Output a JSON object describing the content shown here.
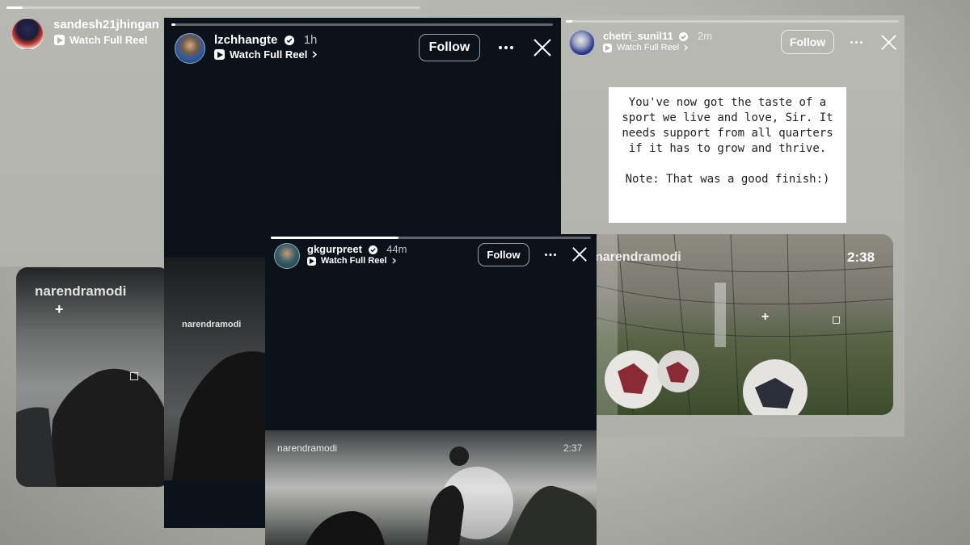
{
  "colors": {
    "dark_panel": "#0b121a",
    "follow_border": "#d0d0d0"
  },
  "card_sandesh": {
    "username": "sandesh21jhingan",
    "reel_link": "Watch Full Reel"
  },
  "card_lz": {
    "username": "lzchhangte",
    "time": "1h",
    "reel_link": "Watch Full Reel",
    "follow": "Follow",
    "video_watermark": "narendramodi"
  },
  "card_chetri": {
    "username": "chetri_sunil11",
    "time": "2m",
    "reel_link": "Watch Full Reel",
    "follow": "Follow",
    "note": "You've now got the taste of a sport we live and love, Sir. It needs support from all quarters if it has to grow and thrive.\n\nNote: That was a good finish:)",
    "video_watermark": "narendramodi",
    "duration": "2:38"
  },
  "card_gk": {
    "username": "gkgurpreet",
    "time": "44m",
    "reel_link": "Watch Full Reel",
    "follow": "Follow",
    "video_watermark": "narendramodi",
    "duration": "2:37"
  },
  "left_video": {
    "watermark": "narendramodi"
  },
  "icons": {
    "more": "more-icon",
    "close": "close-icon",
    "play": "play-icon",
    "verified": "verified-badge-icon",
    "chevron": "chevron-right-icon"
  }
}
